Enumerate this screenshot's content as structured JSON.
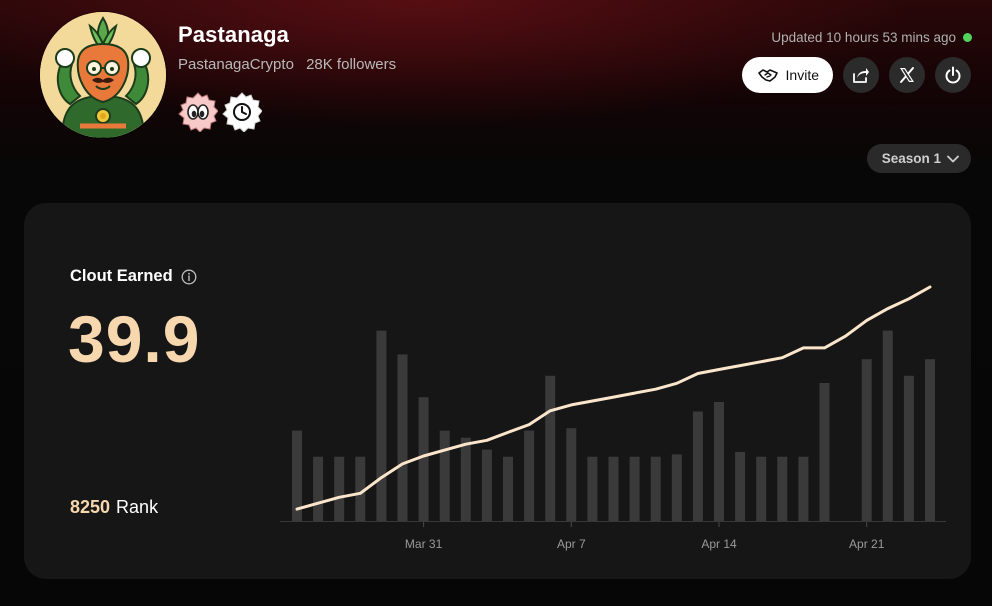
{
  "profile": {
    "name": "Pastanaga",
    "handle": "PastanagaCrypto",
    "followers": "28K followers",
    "avatar": "carrot-mascot-avatar",
    "badges": [
      "eyes-badge",
      "clock-badge"
    ]
  },
  "status": {
    "updated_text": "Updated 10 hours 53 mins ago",
    "live_color": "#52d45c"
  },
  "actions": {
    "invite_label": "Invite",
    "share_icon": "share-icon",
    "x_icon": "x-logo-icon",
    "power_icon": "power-icon"
  },
  "season": {
    "selected": "Season 1"
  },
  "stats": {
    "clout_label": "Clout Earned",
    "clout_value": "39.9",
    "rank_value": "8250",
    "rank_label": "Rank"
  },
  "colors": {
    "accent": "#f6d7ae",
    "bar": "#3a3a3a",
    "line": "#fbe6cc",
    "card": "#161616"
  },
  "chart_data": {
    "type": "bar",
    "x_ticks": [
      "Mar 31",
      "Apr 7",
      "Apr 14",
      "Apr 21"
    ],
    "y_range": [
      0,
      100
    ],
    "series": [
      {
        "type": "bar",
        "values": [
          38,
          27,
          27,
          27,
          80,
          70,
          52,
          38,
          35,
          30,
          27,
          38,
          61,
          39,
          27,
          27,
          27,
          27,
          28,
          46,
          50,
          29,
          27,
          27,
          27,
          58,
          0,
          68,
          80,
          61,
          68
        ]
      },
      {
        "type": "line",
        "values": [
          2,
          5,
          8,
          10,
          18,
          25,
          29,
          32,
          35,
          37,
          41,
          45,
          52,
          55,
          57,
          59,
          61,
          63,
          66,
          71,
          73,
          75,
          77,
          79,
          84,
          84,
          90,
          98,
          104,
          109,
          115
        ]
      }
    ]
  }
}
